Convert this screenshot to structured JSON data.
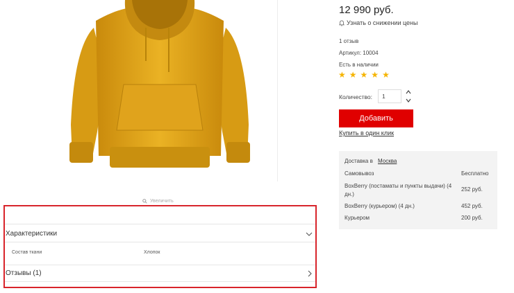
{
  "product": {
    "price": "12 990 руб.",
    "notify_text": "Узнать о снижении цены",
    "reviews_count": "1 отзыв",
    "article": "Артикул: 10004",
    "availability": "Есть в наличии",
    "rating": 5,
    "zoom_label": "Увеличить"
  },
  "purchase": {
    "qty_label": "Количество:",
    "qty_value": "1",
    "add_label": "Добавить",
    "one_click_label": "Купить в один клик"
  },
  "delivery": {
    "title_prefix": "Доставка в",
    "city": "Москва",
    "rows": [
      {
        "name": "Самовывоз",
        "price": "Бесплатно"
      },
      {
        "name": "BoxBerry (постаматы и пункты выдачи) (4 дн.)",
        "price": "252 руб."
      },
      {
        "name": "BoxBerry (курьером) (4 дн.)",
        "price": "452 руб."
      },
      {
        "name": "Курьером",
        "price": "200 руб."
      }
    ]
  },
  "tabs": {
    "characteristics_title": "Характеристики",
    "spec_name": "Состав ткани",
    "spec_value": "Хлопок",
    "reviews_title": "Отзывы (1)"
  },
  "colors": {
    "accent": "#e00000",
    "star": "#f5b400",
    "highlight_frame": "#d8232a",
    "product": "#e8ac1a"
  }
}
